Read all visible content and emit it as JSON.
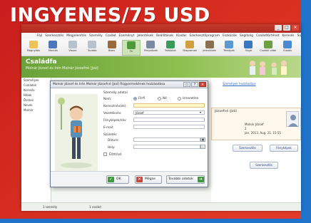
{
  "banner": {
    "text": "INGYENES/75 USD"
  },
  "app": {
    "window_controls": {
      "min": "_",
      "max": "□",
      "close": "×"
    },
    "menu": [
      "Fájl",
      "Szerkesztés",
      "Megjelenítés",
      "Személy",
      "Család",
      "Eseményt",
      "Jelentések",
      "Beállítások",
      "Kiadás",
      "Szerkesztőprogram",
      "Eszközök",
      "Segítség",
      "Családtörténet",
      "Keresés",
      "Súgó"
    ],
    "toolbar": [
      {
        "label": "Megnyitás",
        "icon": "folder-open-icon",
        "color": "#f0c35a"
      },
      {
        "label": "Mentés",
        "icon": "save-icon",
        "color": "#4b78b8"
      },
      {
        "label": "Vissza",
        "icon": "back-arrow-icon",
        "color": "#b8c2cc"
      },
      {
        "label": "Tovább",
        "icon": "forward-arrow-icon",
        "color": "#b8c2cc"
      },
      {
        "label": "Bázis",
        "icon": "home-icon",
        "color": "#9a6a3c"
      },
      {
        "label": "Fa",
        "icon": "tree-icon",
        "color": "#4c9a3a"
      },
      {
        "label": "Fényképek",
        "icon": "photo-icon",
        "color": "#7a8aa0"
      },
      {
        "label": "Találatok",
        "icon": "refresh-icon",
        "color": "#3a9a5a"
      },
      {
        "label": "Diagramok",
        "icon": "chart-icon",
        "color": "#d0a040"
      },
      {
        "label": "Jelentések",
        "icon": "report-icon",
        "color": "#8a7050"
      },
      {
        "label": "Térképek",
        "icon": "map-icon",
        "color": "#5a9ad0"
      },
      {
        "label": "Súgó",
        "icon": "help-icon",
        "color": "#3a78c0"
      },
      {
        "label": "Családi oldal",
        "icon": "family-page-icon",
        "color": "#6aa040"
      },
      {
        "label": "Kiadás",
        "icon": "publish-icon",
        "color": "#4a8ad0"
      }
    ],
    "family": {
      "title": "Családfa",
      "subtitle": "Molnár József és Irén Molnár Józsefné [Joó]"
    },
    "left_panel": [
      "Személyek",
      "Családok",
      "Keresés",
      "Hibák",
      "Összes",
      "Nevek",
      "Molnár"
    ],
    "status": {
      "persons": "3 személy",
      "families": "1 család"
    },
    "right_panel": {
      "link": "Személyek hozzáadása",
      "card_name": "Józsefné (Joó)",
      "card_line1": "Molnár József",
      "card_line2": "2",
      "card_line3": "Jan. 2013. Aug. 21. 15:55",
      "btn_edit": "Szerkesztés",
      "btn_photos": "Fényképek",
      "btn_edit2": "Szerkesztés",
      "btn_more": "Szerkesztés"
    }
  },
  "dialog": {
    "title": "Molnár József és Irén Molnár Józsefné [Joó] fiúgyermekének hozzáadása",
    "section_personal": "Személy adatai",
    "labels": {
      "gender": "Nem:",
      "given_name": "Keresztnév(ek):",
      "surname": "Vezetéknév:",
      "nickname": "Fényképek/név:",
      "email": "E-mail:",
      "birth_section": "Születés",
      "date": "Dátum:",
      "place": "Hely:",
      "living": "Él(tt)hat"
    },
    "gender_options": [
      "Férfi",
      "Nő",
      "Ismeretlen"
    ],
    "gender_selected": "Férfi",
    "values": {
      "given_name": "",
      "surname": "József",
      "nickname": "",
      "email": "",
      "date": "",
      "place": ""
    },
    "buttons": {
      "ok": "OK",
      "cancel": "Mégse",
      "more": "További adatok"
    }
  }
}
